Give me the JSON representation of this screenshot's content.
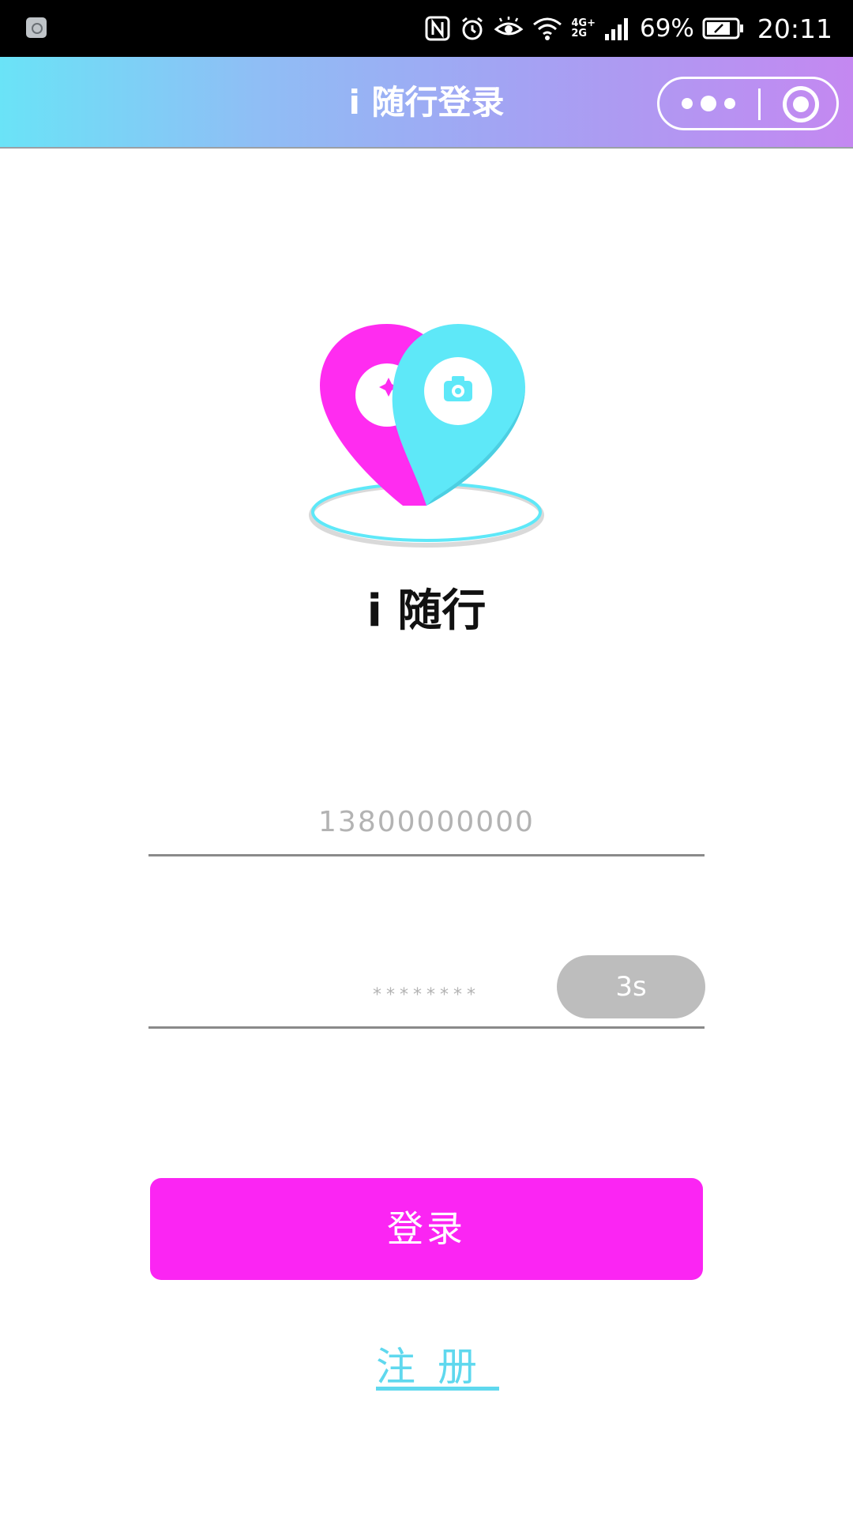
{
  "status_bar": {
    "network_label": "4G+\n2G",
    "battery_percent": "69%",
    "time": "20:11",
    "icons": [
      "app-notification-icon",
      "nfc-icon",
      "alarm-icon",
      "eye-comfort-icon",
      "wifi-icon",
      "signal-icon",
      "battery-icon"
    ]
  },
  "nav": {
    "title": "i 随行登录",
    "icons": [
      "more-dots-icon",
      "close-target-icon"
    ]
  },
  "app": {
    "name": "i 随行",
    "logo_colors": {
      "left_pin": "#ff2cf0",
      "right_pin": "#5ee8f8"
    }
  },
  "form": {
    "phone_placeholder": "13800000000",
    "code_placeholder": "********",
    "countdown_label": "3s"
  },
  "actions": {
    "login_label": "登录",
    "register_label": "注册"
  },
  "colors": {
    "accent_pink": "#fb25f3",
    "accent_cyan": "#5fd8ee",
    "countdown_bg": "#bdbdbd"
  }
}
